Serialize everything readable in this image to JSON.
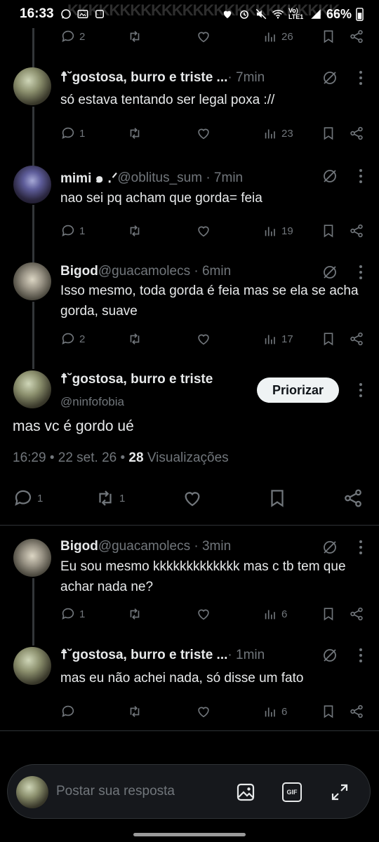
{
  "status_bar": {
    "time": "16:33",
    "ghost_text": "KKKKKKKKKKKKKKKKKKKKKKKKKK",
    "network": "Vo) LTE1",
    "battery": "66%"
  },
  "tweets": [
    {
      "replies": "2",
      "retweets": "",
      "likes": "",
      "views": "26"
    },
    {
      "name": "☨˘gostosa, burro e triste ...",
      "meta": " · 7min",
      "text": "só estava tentando ser legal poxa ://",
      "replies": "1",
      "views": "23"
    },
    {
      "name": "mimi ๑ ․ᐟ",
      "meta": " @oblitus_sum · 7min",
      "text": "nao sei pq acham que gorda= feia",
      "replies": "1",
      "views": "19"
    },
    {
      "name": "Bigod",
      "meta": " @guacamolecs · 6min",
      "text": "Isso mesmo, toda gorda é feia mas se ela se acha gorda, suave",
      "replies": "2",
      "views": "17"
    }
  ],
  "main_tweet": {
    "name": "☨˘gostosa, burro e triste",
    "handle": "@ninfofobia",
    "prioritize_label": "Priorizar",
    "text": "mas vc é gordo ué",
    "time": "16:29 • 22 set. 26 • ",
    "views_count": "28",
    "views_label": " Visualizações",
    "replies": "1",
    "retweets": "1"
  },
  "replies": [
    {
      "name": "Bigod",
      "meta": " @guacamolecs · 3min",
      "text": "Eu sou mesmo kkkkkkkkkkkkk mas c tb tem que achar nada ne?",
      "replies": "1",
      "views": "6"
    },
    {
      "name": "☨˘gostosa, burro e triste ...",
      "meta": " · 1min",
      "text": "mas eu não achei nada, só disse um fato",
      "replies": "",
      "views": "6"
    }
  ],
  "reply_bar": {
    "placeholder": "Postar sua resposta",
    "gif_label": "GIF"
  },
  "colors": {
    "background": "#000000",
    "text": "#e7e9ea",
    "muted": "#71767b",
    "divider": "#2f3336"
  }
}
